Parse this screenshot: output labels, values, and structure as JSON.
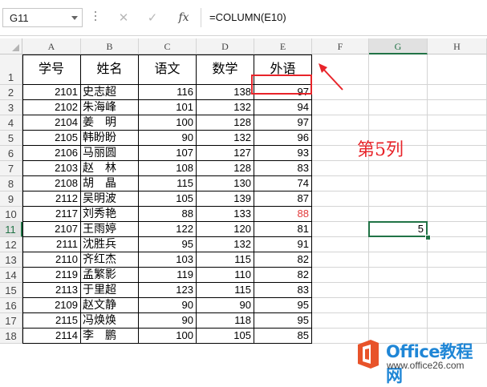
{
  "formula_bar": {
    "name_box": "G11",
    "cancel_icon": "✕",
    "enter_icon": "✓",
    "fx_label": "fx",
    "formula": "=COLUMN(E10)"
  },
  "columns": [
    "A",
    "B",
    "C",
    "D",
    "E",
    "F",
    "G",
    "H"
  ],
  "selected_column": "G",
  "selected_row": "11",
  "headers": [
    "学号",
    "姓名",
    "语文",
    "数学",
    "外语"
  ],
  "rows": [
    {
      "row": "1"
    },
    {
      "row": "2",
      "id": "2101",
      "name": "史志超",
      "chinese": "116",
      "math": "138",
      "english": "97"
    },
    {
      "row": "3",
      "id": "2102",
      "name": "朱海峰",
      "chinese": "101",
      "math": "132",
      "english": "94"
    },
    {
      "row": "4",
      "id": "2104",
      "name": "姜　明",
      "chinese": "100",
      "math": "128",
      "english": "97"
    },
    {
      "row": "5",
      "id": "2105",
      "name": "韩盼盼",
      "chinese": "90",
      "math": "132",
      "english": "96"
    },
    {
      "row": "6",
      "id": "2106",
      "name": "马丽圆",
      "chinese": "107",
      "math": "127",
      "english": "93"
    },
    {
      "row": "7",
      "id": "2103",
      "name": "赵　林",
      "chinese": "108",
      "math": "128",
      "english": "83"
    },
    {
      "row": "8",
      "id": "2108",
      "name": "胡　晶",
      "chinese": "115",
      "math": "130",
      "english": "74"
    },
    {
      "row": "9",
      "id": "2112",
      "name": "吴明波",
      "chinese": "105",
      "math": "139",
      "english": "87"
    },
    {
      "row": "10",
      "id": "2117",
      "name": "刘秀艳",
      "chinese": "88",
      "math": "133",
      "english": "88"
    },
    {
      "row": "11",
      "id": "2107",
      "name": "王雨婷",
      "chinese": "122",
      "math": "120",
      "english": "81"
    },
    {
      "row": "12",
      "id": "2111",
      "name": "沈胜兵",
      "chinese": "95",
      "math": "132",
      "english": "91"
    },
    {
      "row": "13",
      "id": "2110",
      "name": "齐红杰",
      "chinese": "103",
      "math": "115",
      "english": "82"
    },
    {
      "row": "14",
      "id": "2119",
      "name": "孟繁影",
      "chinese": "119",
      "math": "110",
      "english": "82"
    },
    {
      "row": "15",
      "id": "2113",
      "name": "于里超",
      "chinese": "123",
      "math": "115",
      "english": "83"
    },
    {
      "row": "16",
      "id": "2109",
      "name": "赵文静",
      "chinese": "90",
      "math": "90",
      "english": "95"
    },
    {
      "row": "17",
      "id": "2115",
      "name": "冯焕焕",
      "chinese": "90",
      "math": "118",
      "english": "95"
    },
    {
      "row": "18",
      "id": "2114",
      "name": "李　鹏",
      "chinese": "100",
      "math": "105",
      "english": "85"
    }
  ],
  "red_value_color": "#e23a3a",
  "g11_value": "5",
  "annotation": "第5列",
  "annotation_color": "#e8242a",
  "watermark": {
    "title": "Office教程网",
    "url": "www.office26.com",
    "icon": "office-logo-icon"
  }
}
